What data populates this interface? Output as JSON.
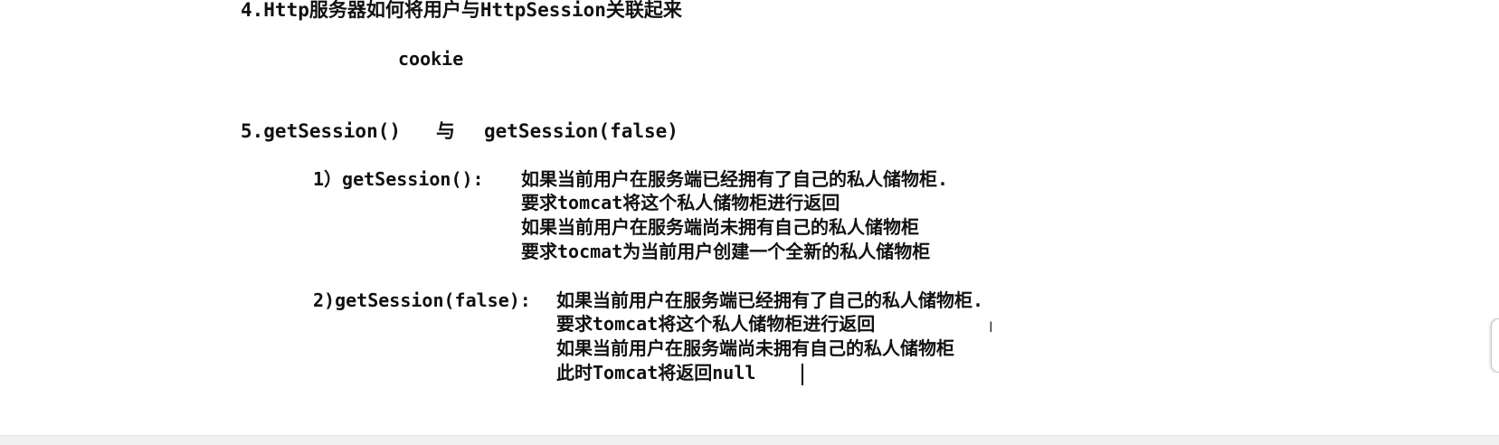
{
  "doc": {
    "heading4": "4.Http服务器如何将用户与HttpSession关联起来",
    "answer4": "cookie",
    "heading5_a": "5.getSession()",
    "heading5_sep": "与",
    "heading5_b": "getSession(false)",
    "item1_label": "1）getSession():",
    "item1_lines": [
      "如果当前用户在服务端已经拥有了自己的私人储物柜.",
      "要求tomcat将这个私人储物柜进行返回",
      "如果当前用户在服务端尚未拥有自己的私人储物柜",
      "要求tocmat为当前用户创建一个全新的私人储物柜"
    ],
    "item2_label": "2)getSession(false):",
    "item2_lines": [
      "如果当前用户在服务端已经拥有了自己的私人储物柜.",
      "要求tomcat将这个私人储物柜进行返回",
      "如果当前用户在服务端尚未拥有自己的私人储物柜",
      "此时Tomcat将返回null"
    ]
  }
}
